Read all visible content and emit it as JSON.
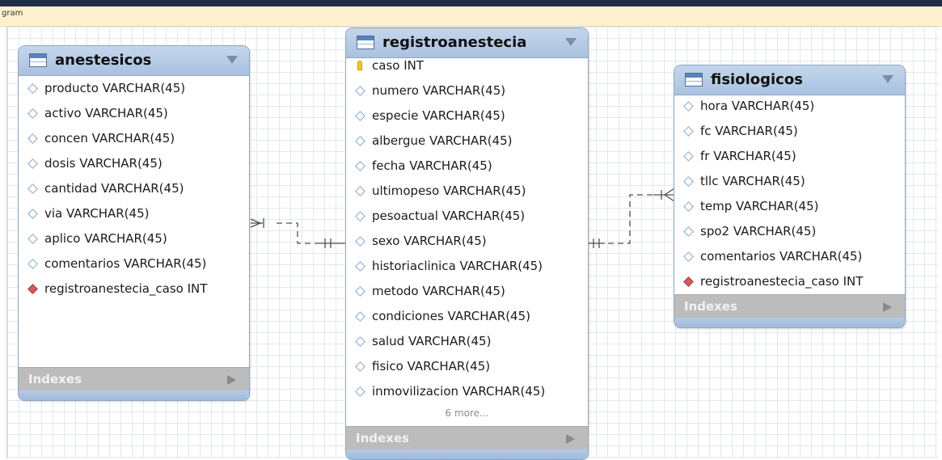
{
  "tab": {
    "label": "gram"
  },
  "entities": {
    "anestesicos": {
      "title": "anestesicos",
      "columns": [
        {
          "icon": "attribute-icon",
          "text": "producto VARCHAR(45)"
        },
        {
          "icon": "attribute-icon",
          "text": "activo VARCHAR(45)"
        },
        {
          "icon": "attribute-icon",
          "text": "concen VARCHAR(45)"
        },
        {
          "icon": "attribute-icon",
          "text": "dosis VARCHAR(45)"
        },
        {
          "icon": "attribute-icon",
          "text": "cantidad VARCHAR(45)"
        },
        {
          "icon": "attribute-icon",
          "text": "via VARCHAR(45)"
        },
        {
          "icon": "attribute-icon",
          "text": "aplico VARCHAR(45)"
        },
        {
          "icon": "attribute-icon",
          "text": "comentarios VARCHAR(45)"
        },
        {
          "icon": "foreign-key-icon",
          "text": "registroanestecia_caso INT"
        }
      ],
      "indexes_label": "Indexes"
    },
    "registroanestecia": {
      "title": "registroanestecia",
      "columns": [
        {
          "icon": "primary-key-icon",
          "text": "caso INT"
        },
        {
          "icon": "attribute-icon",
          "text": "numero VARCHAR(45)"
        },
        {
          "icon": "attribute-icon",
          "text": "especie VARCHAR(45)"
        },
        {
          "icon": "attribute-icon",
          "text": "albergue VARCHAR(45)"
        },
        {
          "icon": "attribute-icon",
          "text": "fecha VARCHAR(45)"
        },
        {
          "icon": "attribute-icon",
          "text": "ultimopeso VARCHAR(45)"
        },
        {
          "icon": "attribute-icon",
          "text": "pesoactual VARCHAR(45)"
        },
        {
          "icon": "attribute-icon",
          "text": "sexo VARCHAR(45)"
        },
        {
          "icon": "attribute-icon",
          "text": "historiaclinica VARCHAR(45)"
        },
        {
          "icon": "attribute-icon",
          "text": "metodo VARCHAR(45)"
        },
        {
          "icon": "attribute-icon",
          "text": "condiciones VARCHAR(45)"
        },
        {
          "icon": "attribute-icon",
          "text": "salud VARCHAR(45)"
        },
        {
          "icon": "attribute-icon",
          "text": "fisico VARCHAR(45)"
        },
        {
          "icon": "attribute-icon",
          "text": "inmovilizacion VARCHAR(45)"
        }
      ],
      "more_label": "6 more...",
      "indexes_label": "Indexes"
    },
    "fisiologicos": {
      "title": "fisiologicos",
      "columns": [
        {
          "icon": "attribute-icon",
          "text": "hora VARCHAR(45)"
        },
        {
          "icon": "attribute-icon",
          "text": "fc VARCHAR(45)"
        },
        {
          "icon": "attribute-icon",
          "text": "fr VARCHAR(45)"
        },
        {
          "icon": "attribute-icon",
          "text": "tllc VARCHAR(45)"
        },
        {
          "icon": "attribute-icon",
          "text": "temp VARCHAR(45)"
        },
        {
          "icon": "attribute-icon",
          "text": "spo2 VARCHAR(45)"
        },
        {
          "icon": "attribute-icon",
          "text": "comentarios VARCHAR(45)"
        },
        {
          "icon": "foreign-key-icon",
          "text": "registroanestecia_caso INT"
        }
      ],
      "indexes_label": "Indexes"
    }
  },
  "relationships": [
    {
      "from": "anestesicos",
      "to": "registroanestecia",
      "from_end": "many",
      "to_end": "one"
    },
    {
      "from": "registroanestecia",
      "to": "fisiologicos",
      "from_end": "one",
      "to_end": "many"
    }
  ]
}
